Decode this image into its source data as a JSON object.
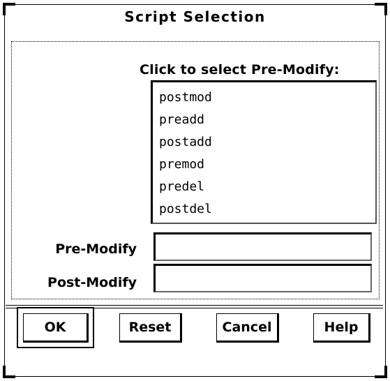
{
  "dialog": {
    "title": "Script Selection",
    "list_caption": "Click to select Pre-Modify:",
    "scripts": [
      "postmod",
      "preadd",
      "postadd",
      "premod",
      "predel",
      "postdel"
    ],
    "pre_modify_label": "Pre-Modify",
    "pre_modify_value": "",
    "post_modify_label": "Post-Modify",
    "post_modify_value": ""
  },
  "buttons": {
    "ok": "OK",
    "reset": "Reset",
    "cancel": "Cancel",
    "help": "Help"
  }
}
